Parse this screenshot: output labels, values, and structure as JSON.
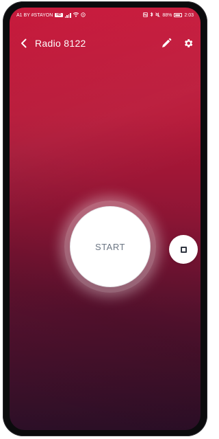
{
  "status_bar": {
    "carrier": "A1 BY #STAYON",
    "carrier_badge": "HD",
    "battery_text": "88%",
    "time": "2:03",
    "battery_level": 0.88
  },
  "app_bar": {
    "title": "Radio 8122",
    "back_icon": "chevron-left-icon",
    "edit_icon": "pencil-icon",
    "settings_icon": "gear-icon"
  },
  "controls": {
    "start_label": "START",
    "stop_icon": "stop-square-icon"
  },
  "colors": {
    "gradient_top": "#c71a3c",
    "gradient_bottom": "#2c0f27",
    "start_text": "#6b7583",
    "stop_icon": "#2f3540"
  }
}
